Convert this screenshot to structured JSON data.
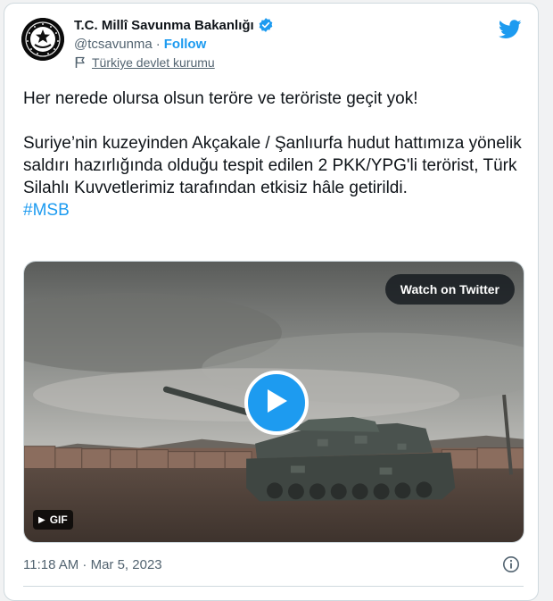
{
  "account": {
    "name": "T.C. Millî Savunma Bakanlığı",
    "handle": "@tcsavunma",
    "separator": "·",
    "follow_label": "Follow",
    "label": "Türkiye devlet kurumu",
    "verified_color": "#1d9bf0"
  },
  "tweet": {
    "line1": "Her nerede olursa olsun teröre ve teröriste geçit yok!",
    "line2": "Suriye’nin kuzeyinden Akçakale / Şanlıurfa hudut hattımıza yönelik saldırı hazırlığında olduğu tespit edilen 2 PKK/YPG'li terörist, Türk Silahlı Kuvvetlerimiz tarafından etkisiz hâle getirildi.",
    "hashtag": "#MSB"
  },
  "media": {
    "watch_label": "Watch on Twitter",
    "gif_label": "GIF"
  },
  "footer": {
    "timestamp": "11:18 AM · Mar 5, 2023"
  },
  "icons": {
    "logo": "twitter-bird-icon",
    "verified": "verified-badge-icon",
    "label": "flag-icon",
    "play": "play-icon",
    "info": "info-icon"
  },
  "colors": {
    "accent": "#1d9bf0",
    "text": "#0f1419",
    "muted": "#536471"
  }
}
